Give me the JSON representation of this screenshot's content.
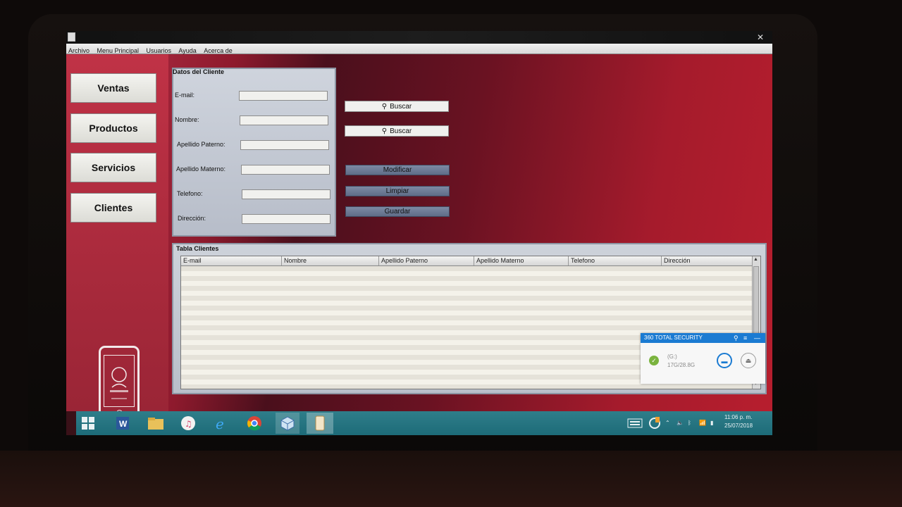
{
  "menu": [
    "Archivo",
    "Menu Principal",
    "Usuarios",
    "Ayuda",
    "Acerca de"
  ],
  "nav": [
    "Ventas",
    "Productos",
    "Servicios",
    "Clientes"
  ],
  "datos": {
    "title": "Datos del Cliente",
    "fields": [
      {
        "label": "E-mail:",
        "value": ""
      },
      {
        "label": "Nombre:",
        "value": ""
      },
      {
        "label": "Apellido Paterno:",
        "value": ""
      },
      {
        "label": "Apellido Materno:",
        "value": ""
      },
      {
        "label": "Telefono:",
        "value": ""
      },
      {
        "label": "Dirección:",
        "value": ""
      }
    ]
  },
  "buttons": {
    "buscar1": "Buscar",
    "buscar2": "Buscar",
    "modificar": "Modificar",
    "limpiar": "Limpiar",
    "guardar": "Guardar"
  },
  "tabla": {
    "title": "Tabla Clientes",
    "headers": [
      "E-mail",
      "Nombre",
      "Apellido Paterno",
      "Apellido Materno",
      "Telefono",
      "Dirección"
    ]
  },
  "popup": {
    "title": "360 TOTAL SECURITY",
    "drive": "(G:)",
    "size": "17G/28.8G"
  },
  "taskbar": {
    "apps": [
      "start-button",
      "word-icon",
      "file-explorer-icon",
      "itunes-icon",
      "internet-explorer-icon",
      "chrome-icon",
      "virtualbox-icon",
      "java-app-icon"
    ],
    "time": "11:06 p. m.",
    "date": "25/07/2018"
  },
  "colors": {
    "accent": "#a51b2c",
    "taskbar": "#1d6b78",
    "security": "#1b7bd2"
  }
}
